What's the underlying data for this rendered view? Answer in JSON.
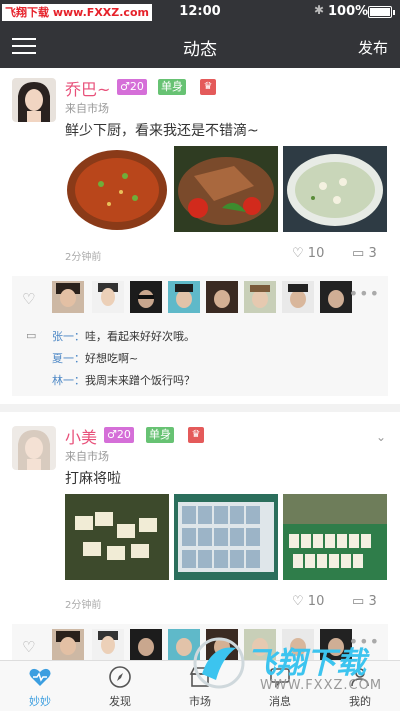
{
  "status_bar": {
    "watermark_red": "飞翔下载",
    "watermark_url": "www.FXXZ.com",
    "time": "12:00",
    "battery": "100%",
    "accent": "#333438"
  },
  "nav": {
    "title": "动态",
    "publish": "发布"
  },
  "posts": [
    {
      "name": "乔巴~",
      "gender_badge": "♂20",
      "status_badge": "单身",
      "crown": "♛",
      "source": "来自市场",
      "content": "鲜少下厨，看来我还是不错滴~",
      "time": "2分钟前",
      "likes": "10",
      "comments": "3",
      "photos": [
        "fish-dish",
        "meat-peppers",
        "egg-soup"
      ],
      "comments_list": [
        {
          "user": "张一：",
          "text": "哇，看起来好好次哦。"
        },
        {
          "user": "夏一：",
          "text": "好想吃啊~"
        },
        {
          "user": "林一：",
          "text": "我周末来蹭个饭行吗？"
        }
      ],
      "more": "•••"
    },
    {
      "name": "小美",
      "gender_badge": "♂20",
      "status_badge": "单身",
      "crown": "♛",
      "source": "来自市场",
      "content": "打麻将啦",
      "time": "2分钟前",
      "likes": "10",
      "comments": "3",
      "photos": [
        "mahjong-1",
        "mahjong-2",
        "mahjong-3"
      ],
      "more": "•••"
    }
  ],
  "tabs": [
    {
      "label": "妙妙",
      "icon": "heart-pulse-icon",
      "active": true
    },
    {
      "label": "发现",
      "icon": "compass-icon",
      "active": false
    },
    {
      "label": "市场",
      "icon": "market-icon",
      "active": false
    },
    {
      "label": "消息",
      "icon": "message-icon",
      "active": false
    },
    {
      "label": "我的",
      "icon": "profile-icon",
      "active": false
    }
  ],
  "overlay": {
    "brand": "飞翔下载",
    "url": "WWW.FXXZ.COM"
  }
}
